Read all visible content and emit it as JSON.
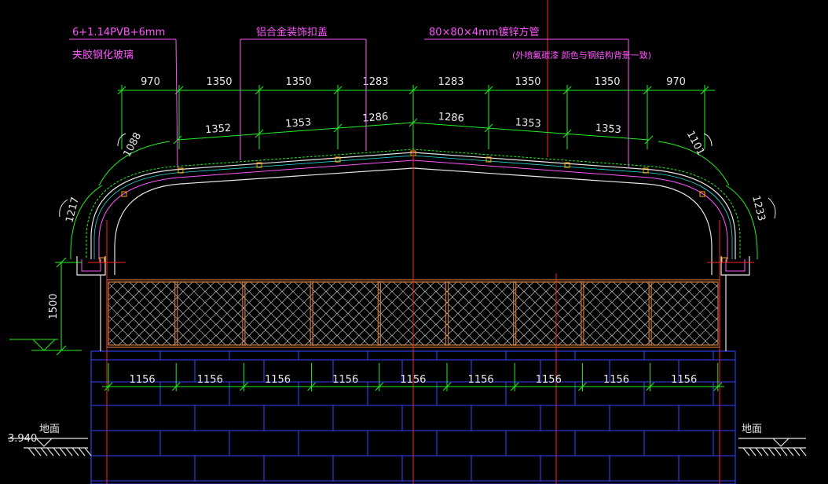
{
  "annotations": {
    "glass_spec": "6+1.14PVB+6mm",
    "glass_name": "夹胶钢化玻璃",
    "cover_cap": "铝合金装饰扣盖",
    "tube_spec": "80×80×4mm镀锌方管",
    "tube_note": "(外喷氟碳漆 颜色与钢结构背景一致)"
  },
  "dims": {
    "top_row": [
      "970",
      "1350",
      "1350",
      "1283",
      "1283",
      "1350",
      "1350",
      "970"
    ],
    "arc_row": [
      "1352",
      "1353",
      "1286",
      "1286",
      "1353",
      "1353"
    ],
    "arc_left_upper": "1088",
    "arc_right_upper": "1101",
    "arc_left_lower": "1217",
    "arc_right_lower": "1233",
    "wall_height": "1500",
    "bottom_row": [
      "1156",
      "1156",
      "1156",
      "1156",
      "1156",
      "1156",
      "1156",
      "1156",
      "1156"
    ]
  },
  "levels": {
    "elevation": "3.940",
    "ground_left": "地面",
    "ground_right": "地面"
  },
  "colors": {
    "dimension_lines": "#22ee22",
    "annotation_text": "#ff55ff",
    "axis_lines": "#ff2222",
    "masonry": "#3344ff",
    "steel_frame": "#c87a3c"
  }
}
